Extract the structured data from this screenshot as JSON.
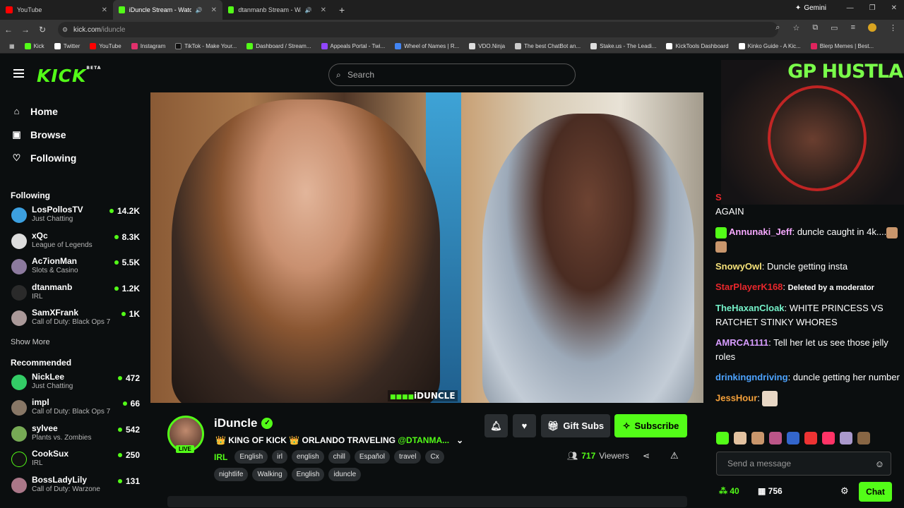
{
  "browser": {
    "tabs": [
      {
        "label": "YouTube",
        "color": "#ff0000"
      },
      {
        "label": "iDuncle Stream - Watch Live",
        "color": "#53fc18"
      },
      {
        "label": "dtanmanb Stream - Watch Live",
        "color": "#53fc18"
      }
    ],
    "gemini": "Gemini",
    "url_host": "kick.com",
    "url_path": "/iduncle",
    "bookmarks": [
      "Kick",
      "Twitter",
      "YouTube",
      "Instagram",
      "TikTok - Make Your...",
      "Dashboard / Stream...",
      "Appeals Portal - Twi...",
      "Wheel of Names | R...",
      "VDO.Ninja",
      "The best ChatBot an...",
      "Stake.us - The Leadi...",
      "KickTools Dashboard",
      "Kinko Guide - A Kic...",
      "Blerp Memes | Best..."
    ]
  },
  "header": {
    "logo": "KICK",
    "logo_beta": "BETA",
    "search_placeholder": "Search"
  },
  "sidebar": {
    "nav": [
      {
        "label": "Home",
        "icon": "home-icon"
      },
      {
        "label": "Browse",
        "icon": "browse-icon"
      },
      {
        "label": "Following",
        "icon": "heart-icon"
      }
    ],
    "following_title": "Following",
    "following": [
      {
        "name": "LosPollosTV",
        "category": "Just Chatting",
        "viewers": "14.2K"
      },
      {
        "name": "xQc",
        "category": "League of Legends",
        "viewers": "8.3K"
      },
      {
        "name": "Ac7ionMan",
        "category": "Slots & Casino",
        "viewers": "5.5K"
      },
      {
        "name": "dtanmanb",
        "category": "IRL",
        "viewers": "1.2K"
      },
      {
        "name": "SamXFrank",
        "category": "Call of Duty: Black Ops 7",
        "viewers": "1K"
      }
    ],
    "show_more": "Show More",
    "recommended_title": "Recommended",
    "recommended": [
      {
        "name": "NickLee",
        "category": "Just Chatting",
        "viewers": "472"
      },
      {
        "name": "impl",
        "category": "Call of Duty: Black Ops 7",
        "viewers": "66"
      },
      {
        "name": "sylvee",
        "category": "Plants vs. Zombies",
        "viewers": "542"
      },
      {
        "name": "CookSux",
        "category": "IRL",
        "viewers": "250"
      },
      {
        "name": "BossLadyLily",
        "category": "Call of Duty: Warzone",
        "viewers": "131"
      }
    ]
  },
  "stream": {
    "watermark": "iDUNCLE",
    "streamer": "iDuncle",
    "live_badge": "LIVE",
    "title_prefix": "👑 KING OF KICK 👑 ORLANDO TRAVELING ",
    "title_mention": "@DTANMA...",
    "category": "IRL",
    "tags": [
      "English",
      "irl",
      "english",
      "chill",
      "Español",
      "travel",
      "Cx"
    ],
    "tags2": [
      "nightlife",
      "Walking",
      "English",
      "iduncle"
    ],
    "gift_label": "Gift Subs",
    "subscribe_label": "Subscribe",
    "viewer_count": "717",
    "viewer_label": "Viewers"
  },
  "chat": {
    "cam_overlay": "GP HUSTLA",
    "messages": [
      {
        "user": "S",
        "text": "AGAIN",
        "color": "#e8272c"
      },
      {
        "user": "Annunaki_Jeff",
        "text": "duncle caught in 4k....",
        "color": "#f7a8ff"
      },
      {
        "user": "SnowyOwl",
        "text": "Duncle getting insta",
        "color": "#f6e27a"
      },
      {
        "user": "StarPlayerK168",
        "text": "Deleted by a moderator",
        "color": "#e8272c"
      },
      {
        "user": "TheHaxanCloak",
        "text": "WHITE PRINCESS VS RATCHET STINKY WHORES",
        "color": "#75f2c9"
      },
      {
        "user": "AMRCA1111",
        "text": "Tell her let us see those jelly roles",
        "color": "#d79cff"
      },
      {
        "user": "drinkingndriving",
        "text": "duncle getting her number",
        "color": "#4da3ff"
      },
      {
        "user": "JessHour",
        "text": "",
        "color": "#f6a13a"
      }
    ],
    "input_placeholder": "Send a message",
    "points": "40",
    "subs": "756",
    "chat_button": "Chat"
  }
}
